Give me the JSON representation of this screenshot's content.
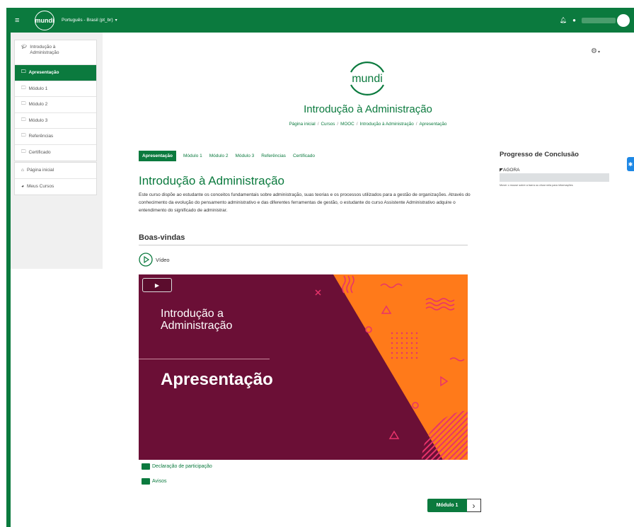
{
  "navbar": {
    "menu_icon": "hamburger-icon",
    "logo_text": "mundi",
    "language": "Português - Brasil (pt_br)",
    "bell_icon": "bell-icon",
    "chat_icon": "chat-icon"
  },
  "drawer": {
    "course_items": [
      {
        "icon": "graduation-cap-icon",
        "label": "Introdução à Administração"
      },
      {
        "icon": "folder-icon",
        "label": "Apresentação",
        "active": true
      },
      {
        "icon": "folder-icon",
        "label": "Módulo 1"
      },
      {
        "icon": "folder-icon",
        "label": "Módulo 2"
      },
      {
        "icon": "folder-icon",
        "label": "Módulo 3"
      },
      {
        "icon": "folder-icon",
        "label": "Referências"
      },
      {
        "icon": "folder-icon",
        "label": "Certificado"
      }
    ],
    "site_items": [
      {
        "icon": "home-icon",
        "label": "Página inicial"
      },
      {
        "icon": "tachometer-icon",
        "label": "Meus Cursos"
      }
    ]
  },
  "header": {
    "logo_text": "mundi",
    "title": "Introdução à Administração",
    "breadcrumb": [
      "Página inicial",
      "Cursos",
      "MOOC",
      "Introdução à Administração",
      "Apresentação"
    ]
  },
  "tabs": [
    "Apresentação",
    "Módulo 1",
    "Módulo 2",
    "Módulo 3",
    "Referências",
    "Certificado"
  ],
  "section": {
    "title": "Introdução à Administração",
    "summary": "Este curso dispõe ao estudante os conceitos fundamentais sobre administração, suas teorias e os processos utilizados para a gestão de organizações. Através do conhecimento da evolução do pensamento administrativo e das diferentes ferramentas de gestão, o estudante do curso Assistente Administrativo adquire o entendimento do significado de administrar.",
    "welcome_heading": "Boas-vindas",
    "video_label": "Vídeo"
  },
  "video": {
    "line1": "Introdução a Administração",
    "big": "Apresentação",
    "colors": {
      "bg": "#6b0f36",
      "orange": "#ff7a1a",
      "accent": "#e8336b"
    }
  },
  "links": [
    {
      "icon": "certificate-icon",
      "label": "Declaração de participação"
    },
    {
      "icon": "announcements-icon",
      "label": "Avisos"
    }
  ],
  "next": {
    "label": "Módulo 1",
    "arrow": "›"
  },
  "progress": {
    "title": "Progresso de Conclusão",
    "now": "AGORA",
    "hint": "Mover o mouse sobre a barra ou clicar nela para informações"
  },
  "colors": {
    "brand": "#0b7a3e"
  }
}
